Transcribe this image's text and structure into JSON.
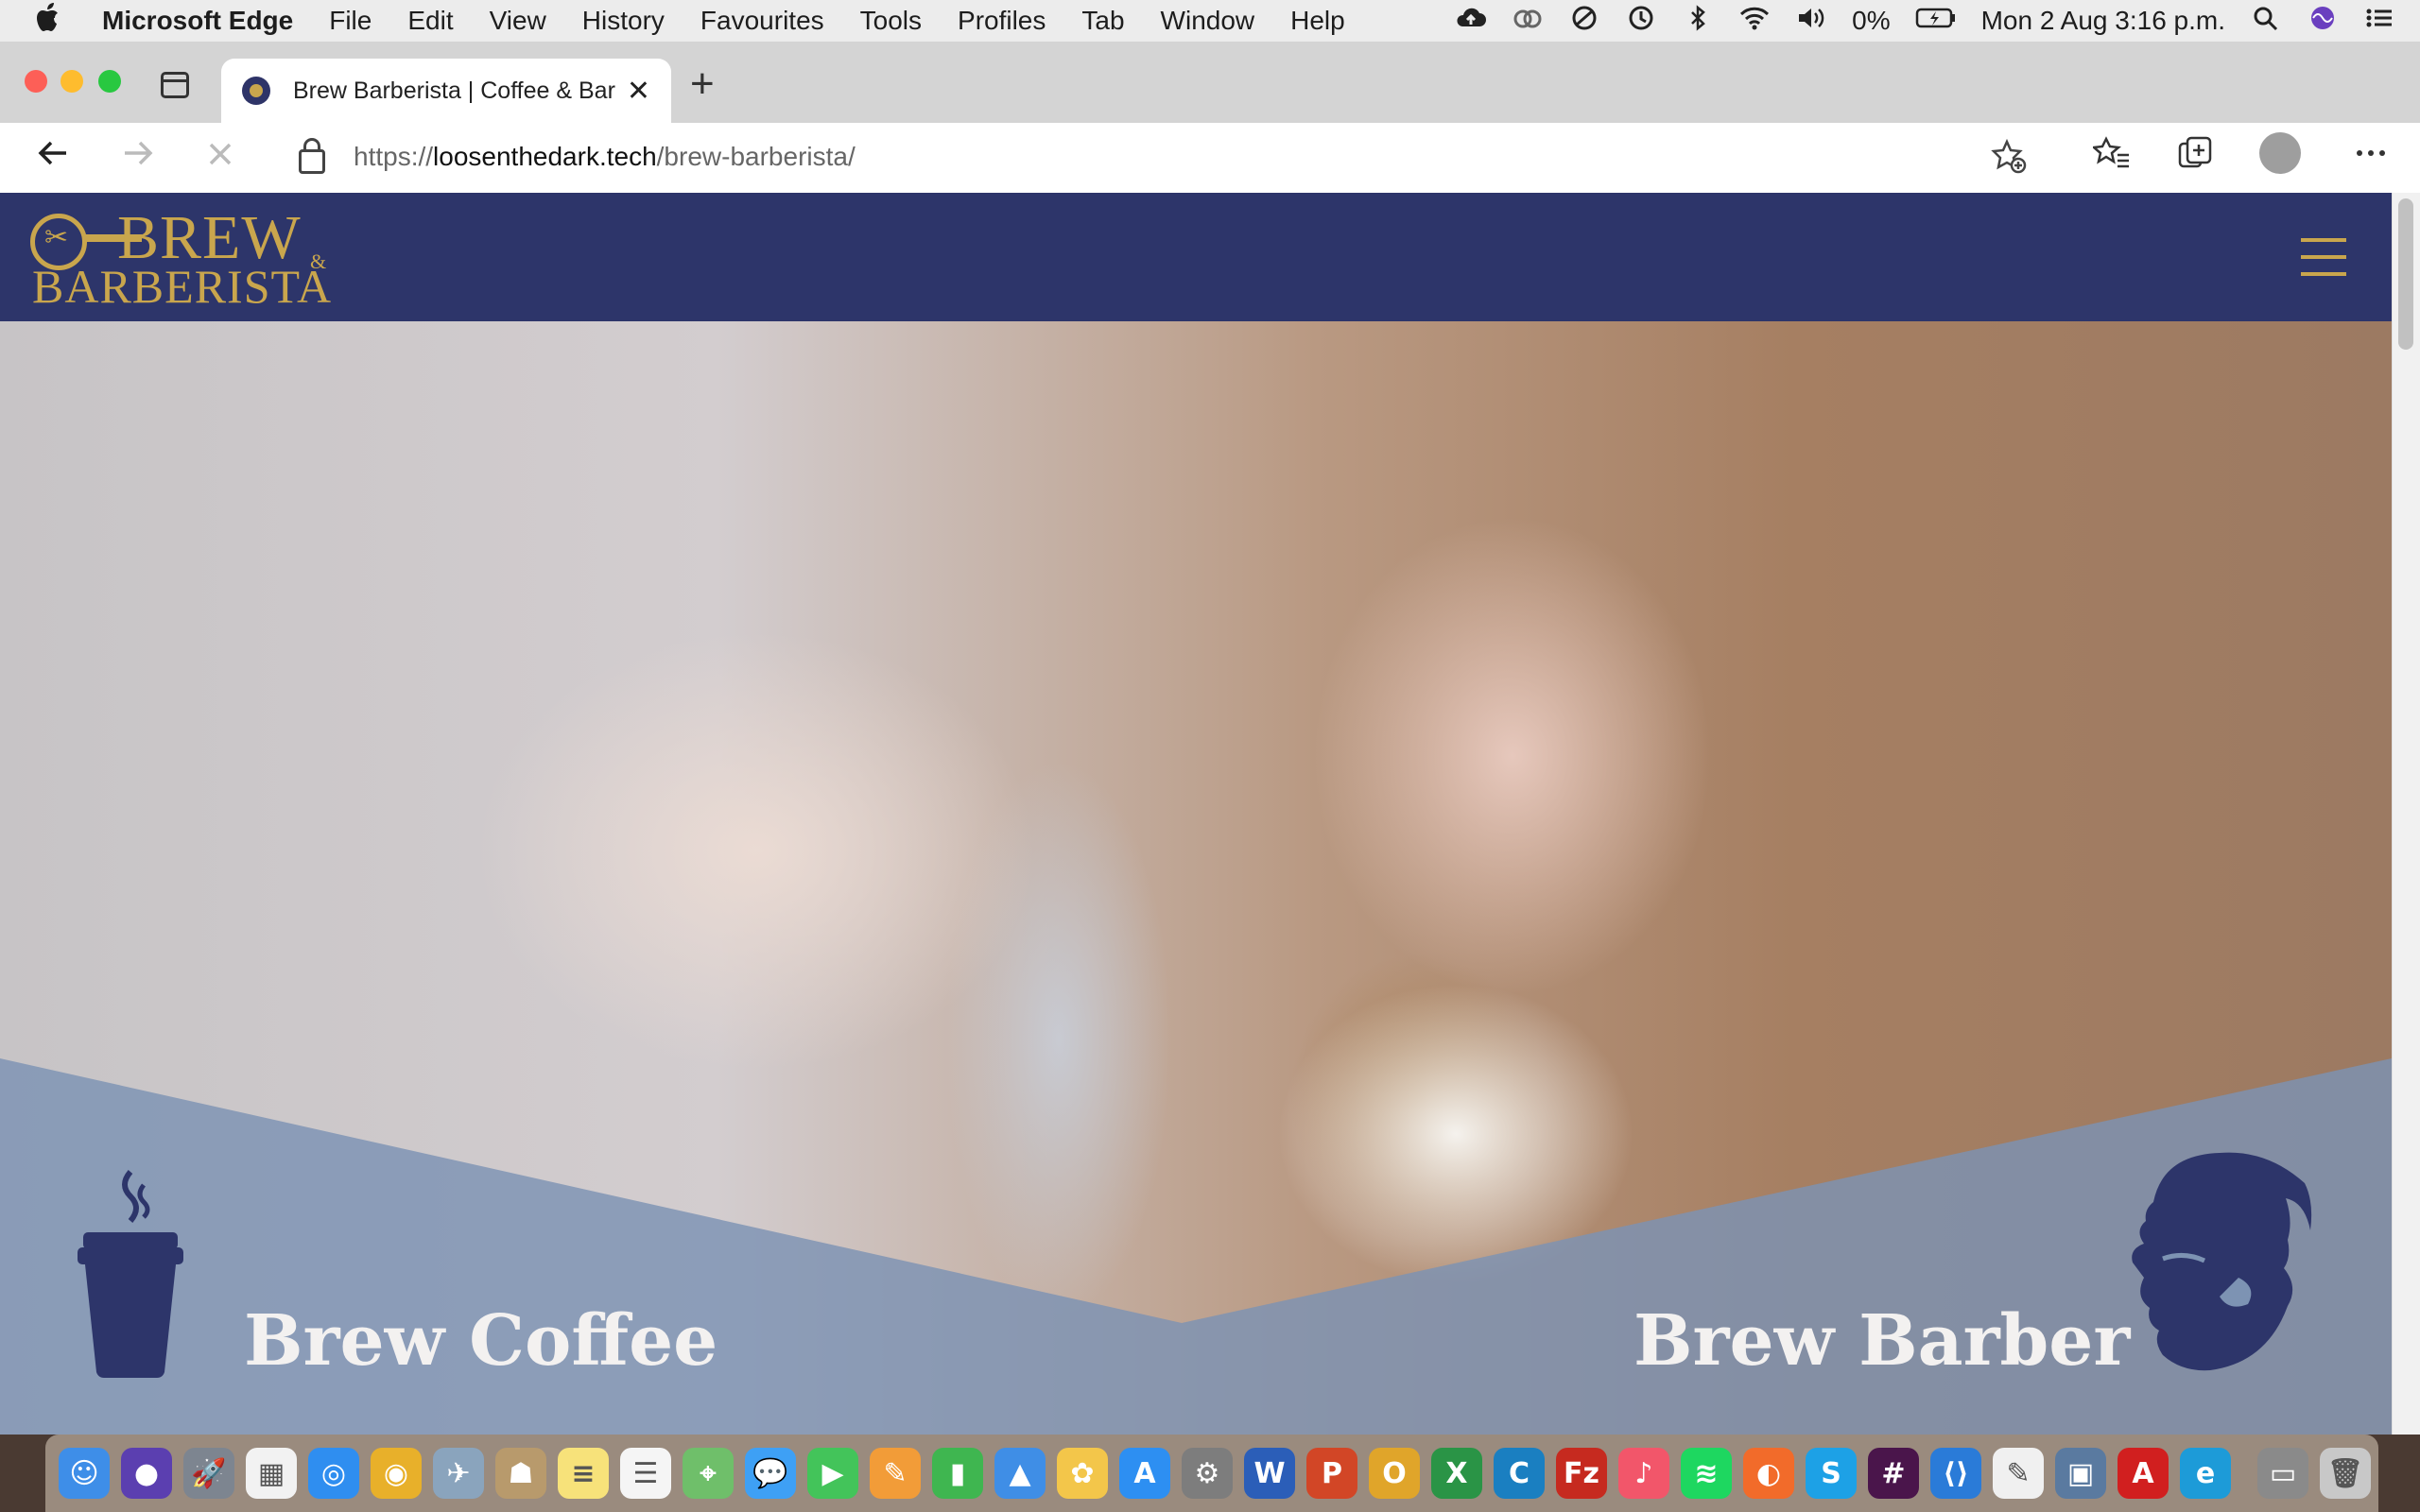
{
  "menubar": {
    "apple": "",
    "items": [
      "Microsoft Edge",
      "File",
      "Edit",
      "View",
      "History",
      "Favourites",
      "Tools",
      "Profiles",
      "Tab",
      "Window",
      "Help"
    ],
    "battery": "0%",
    "datetime": "Mon 2 Aug  3:16 p.m."
  },
  "browser": {
    "tab_title": "Brew Barberista | Coffee & Bar",
    "tab_close": "✕",
    "new_tab": "+",
    "url_prefix": "https://",
    "url_domain": "loosenthedark.tech",
    "url_path": "/brew-barberista/"
  },
  "site": {
    "logo_brew": "BREW",
    "logo_amp": "&",
    "logo_barberista": "BARBERISTA",
    "hero_left_title": "Brew Coffee",
    "hero_right_title": "Brew Barber",
    "colors": {
      "header": "#2d356a",
      "gold": "#c9a64d",
      "band": "#7d93b3"
    }
  },
  "dock": {
    "apps": [
      {
        "name": "finder",
        "glyph": "☺",
        "color": "#3e8ee8"
      },
      {
        "name": "siri",
        "glyph": "●",
        "color": "#5b3fb0"
      },
      {
        "name": "launchpad",
        "glyph": "🚀",
        "color": "#7d8590"
      },
      {
        "name": "app-grid",
        "glyph": "▦",
        "color": "#f2f2f2"
      },
      {
        "name": "safari",
        "glyph": "◎",
        "color": "#2f8ef0"
      },
      {
        "name": "chrome",
        "glyph": "◉",
        "color": "#e8b02a"
      },
      {
        "name": "preview",
        "glyph": "✈",
        "color": "#8aa4bd"
      },
      {
        "name": "contacts",
        "glyph": "☗",
        "color": "#b89a6c"
      },
      {
        "name": "notes",
        "glyph": "≡",
        "color": "#f7e27a"
      },
      {
        "name": "reminders",
        "glyph": "☰",
        "color": "#f5f5f5"
      },
      {
        "name": "maps",
        "glyph": "⌖",
        "color": "#6fbf6a"
      },
      {
        "name": "messages",
        "glyph": "💬",
        "color": "#3ea0f5"
      },
      {
        "name": "facetime",
        "glyph": "▶",
        "color": "#43c45a"
      },
      {
        "name": "pages",
        "glyph": "✎",
        "color": "#f29c38"
      },
      {
        "name": "numbers",
        "glyph": "▮",
        "color": "#3fb650"
      },
      {
        "name": "keynote",
        "glyph": "▲",
        "color": "#3f8ee6"
      },
      {
        "name": "photos",
        "glyph": "✿",
        "color": "#f3c64a"
      },
      {
        "name": "app-store",
        "glyph": "A",
        "color": "#2d8ff2"
      },
      {
        "name": "system-preferences",
        "glyph": "⚙",
        "color": "#7d7d7d"
      },
      {
        "name": "word",
        "glyph": "W",
        "color": "#2b5eb8"
      },
      {
        "name": "powerpoint",
        "glyph": "P",
        "color": "#d24626"
      },
      {
        "name": "outlook",
        "glyph": "O",
        "color": "#e0a52a"
      },
      {
        "name": "excel",
        "glyph": "X",
        "color": "#2a9446"
      },
      {
        "name": "code-c",
        "glyph": "C",
        "color": "#1a7fc1"
      },
      {
        "name": "filezilla",
        "glyph": "Fz",
        "color": "#c62a1f"
      },
      {
        "name": "music",
        "glyph": "♪",
        "color": "#f2566a"
      },
      {
        "name": "spotify",
        "glyph": "≋",
        "color": "#1ed760"
      },
      {
        "name": "firefox",
        "glyph": "◐",
        "color": "#f26b2a"
      },
      {
        "name": "skype",
        "glyph": "S",
        "color": "#1da1e6"
      },
      {
        "name": "slack",
        "glyph": "#",
        "color": "#4a154b"
      },
      {
        "name": "vscode",
        "glyph": "⟨⟩",
        "color": "#2a7bd8"
      },
      {
        "name": "textedit",
        "glyph": "✎",
        "color": "#f0f0f0"
      },
      {
        "name": "image-capture",
        "glyph": "▣",
        "color": "#5a7aa0"
      },
      {
        "name": "acrobat",
        "glyph": "A",
        "color": "#d11f1f"
      },
      {
        "name": "edge",
        "glyph": "e",
        "color": "#1d9bd8"
      },
      {
        "name": "screen-sharing",
        "glyph": "▭",
        "color": "#8a8a8a"
      },
      {
        "name": "trash",
        "glyph": "🗑",
        "color": "#c8c8c8"
      }
    ]
  }
}
